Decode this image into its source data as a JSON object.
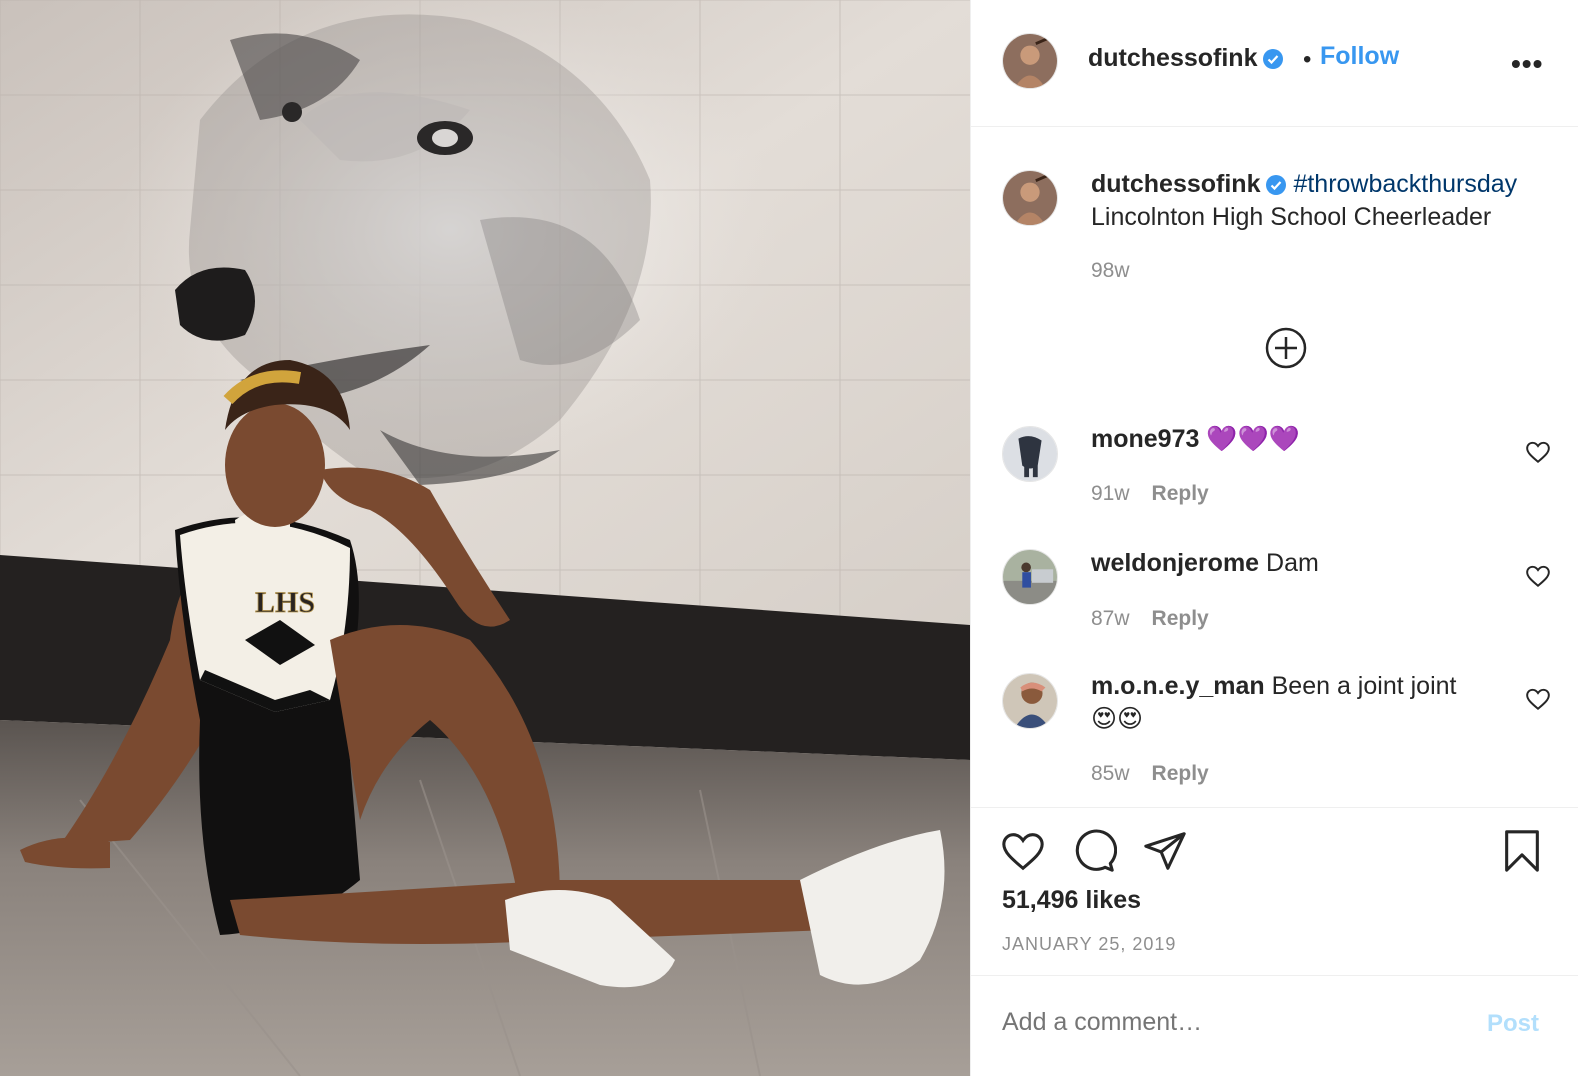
{
  "post": {
    "image_alt": "throwback photo of cheerleader sitting on gym floor in front of wolf mural",
    "header": {
      "username": "dutchessofink",
      "separator": "•",
      "follow_label": "Follow",
      "more_label": "•••"
    },
    "caption": {
      "username": "dutchessofink",
      "hashtag": "#throwbackthursday",
      "text": "Lincolnton High School Cheerleader",
      "age": "98w"
    },
    "comments": [
      {
        "username": "mone973",
        "text": "💜💜💜",
        "age": "91w",
        "reply_label": "Reply"
      },
      {
        "username": "weldonjerome",
        "text": "Dam",
        "age": "87w",
        "reply_label": "Reply"
      },
      {
        "username": "m.o.n.e.y_man",
        "text": "Been a joint joint",
        "emoji": "😍😍",
        "age": "85w",
        "reply_label": "Reply"
      }
    ],
    "likes": "51,496 likes",
    "date": "JANUARY 25, 2019",
    "add_comment_placeholder": "Add a comment…",
    "post_label": "Post"
  },
  "colors": {
    "link_blue": "#3897f0",
    "hashtag": "#00376b",
    "muted": "#8e8e8e",
    "post_disabled": "#b2dffc",
    "verified": "#3897f0"
  },
  "icons": [
    "verified-badge-icon",
    "more-options-icon",
    "load-more-comments-icon",
    "heart-icon",
    "comment-icon",
    "share-icon",
    "bookmark-icon"
  ]
}
